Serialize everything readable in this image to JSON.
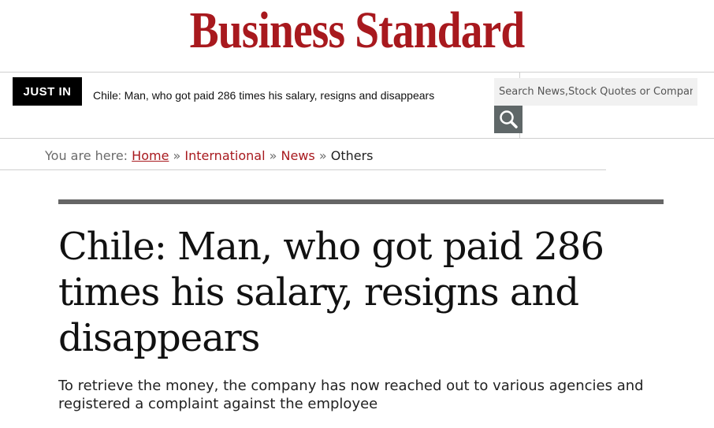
{
  "masthead": {
    "logo_text": "Business Standard"
  },
  "just_in": {
    "badge_label": "JUST IN",
    "headline": "Chile: Man, who got paid 286 times his salary, resigns and disappears"
  },
  "search": {
    "placeholder": "Search News,Stock Quotes or Companies",
    "icon": "search-icon"
  },
  "breadcrumb": {
    "prefix": "You are here:",
    "items": [
      "Home",
      "International",
      "News",
      "Others"
    ],
    "separator": "»"
  },
  "article": {
    "title": "Chile: Man, who got paid 286 times his salary, resigns and disappears",
    "summary": "To retrieve the money, the company has now reached out to various agencies and registered a complaint against the employee"
  },
  "colors": {
    "brand": "#a8191e",
    "badge_bg": "#000000",
    "search_button_bg": "#5f6768",
    "article_rule": "#666666"
  }
}
